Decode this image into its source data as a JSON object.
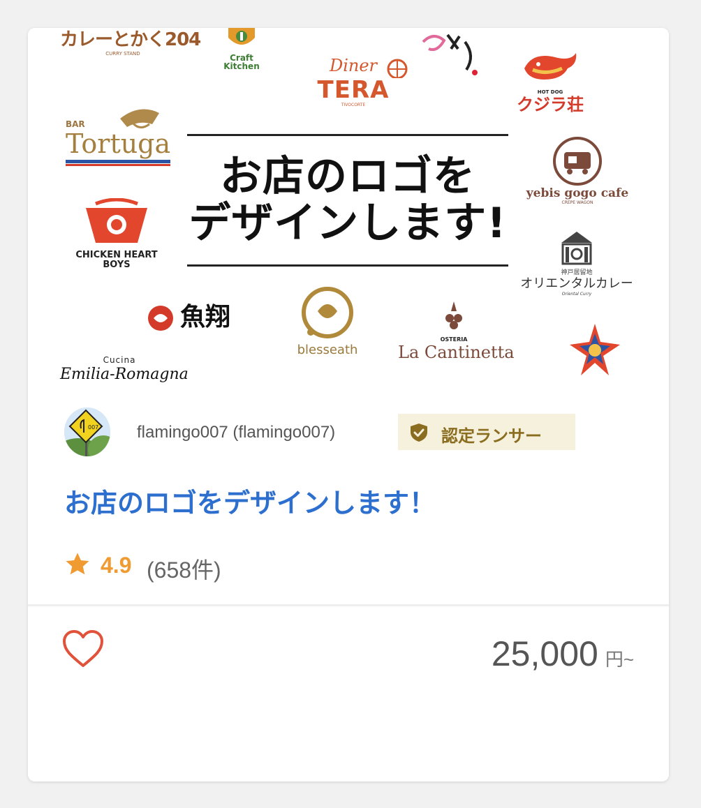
{
  "thumbnail": {
    "headline_line1": "お店のロゴを",
    "headline_line2": "デザインします!",
    "logos": {
      "curry_stand": "カレーとかく204",
      "curry_stand_sub": "CURRY STAND",
      "craft_kitchen_1": "Craft",
      "craft_kitchen_2": "Kitchen",
      "diner": "Diner",
      "tera": "TERA",
      "tera_sub": "TIVOCORTE",
      "hot_dog_small": "HOT DOG",
      "kujira": "クジラ荘",
      "bar_small": "BAR",
      "tortuga": "Tortuga",
      "yebis": "yebis gogo cafe",
      "yebis_sub": "CREPE WAGON",
      "chicken_1": "CHICKEN HEART",
      "chicken_2": "BOYS",
      "oriental_small": "神戸居留地",
      "oriental": "オリエンタルカレー",
      "oriental_sub": "Oriental Curry",
      "uoshou": "魚翔",
      "blesseath": "blesseath",
      "osteria": "OSTERIA",
      "cantinetta": "La Cantinetta",
      "cucina": "Cucina",
      "emilia": "Emilia-Romagna"
    }
  },
  "seller": {
    "name": "flamingo007 (flamingo007)",
    "avatar_sign": "007",
    "badge_label": "認定ランサー"
  },
  "service": {
    "title": "お店のロゴをデザインします！"
  },
  "rating": {
    "value": "4.9",
    "count": "(658件)"
  },
  "price": {
    "amount": "25,000",
    "unit": "円~"
  },
  "colors": {
    "title_blue": "#2d6fcf",
    "rating_orange": "#f09a32",
    "favorite_red": "#e0523a",
    "badge_bg": "#f6f1dc",
    "badge_text": "#8a6d1e"
  },
  "icons": {
    "rating": "star-icon",
    "favorite": "heart-outline-icon",
    "badge": "shield-check-icon"
  }
}
